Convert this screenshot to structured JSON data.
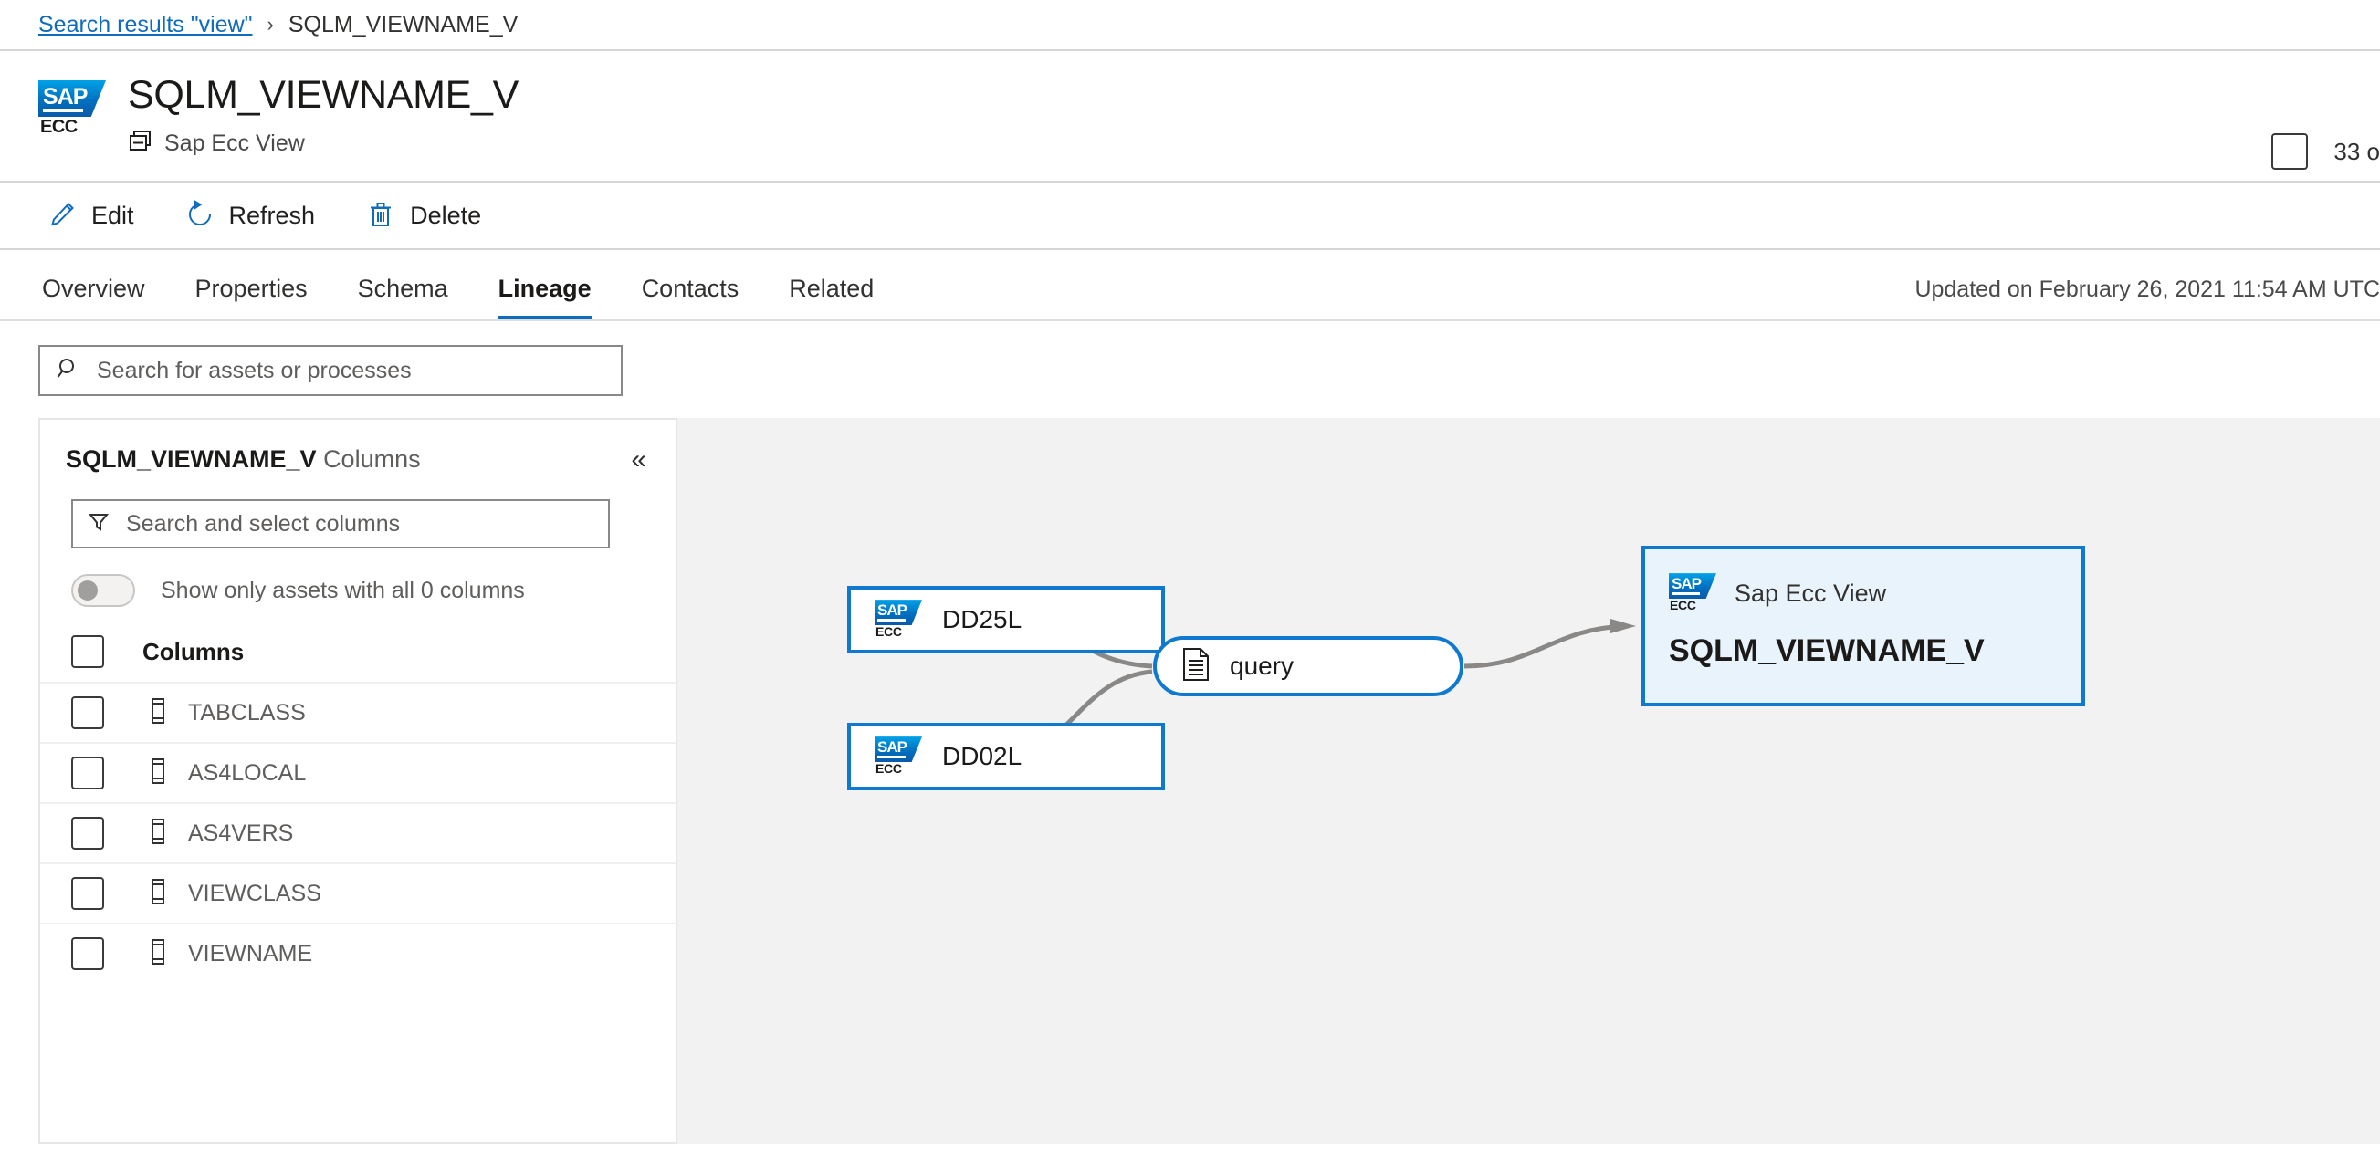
{
  "breadcrumb": {
    "link_label": "Search results \"view\"",
    "separator": "›",
    "current": "SQLM_VIEWNAME_V"
  },
  "header": {
    "title": "SQLM_VIEWNAME_V",
    "subtitle": "Sap Ecc View",
    "logo_sap": "SAP",
    "logo_ecc": "ECC",
    "right_label": "33 o"
  },
  "command_bar": {
    "edit": "Edit",
    "refresh": "Refresh",
    "delete": "Delete"
  },
  "tabs": [
    {
      "label": "Overview",
      "active": false
    },
    {
      "label": "Properties",
      "active": false
    },
    {
      "label": "Schema",
      "active": false
    },
    {
      "label": "Lineage",
      "active": true
    },
    {
      "label": "Contacts",
      "active": false
    },
    {
      "label": "Related",
      "active": false
    }
  ],
  "updated": "Updated on February 26, 2021 11:54 AM UTC",
  "lineage_search": {
    "placeholder": "Search for assets or processes",
    "value": ""
  },
  "columns_panel": {
    "title_bold": "SQLM_VIEWNAME_V",
    "title_light": "Columns",
    "collapse_icon": "«",
    "filter_placeholder": "Search and select columns",
    "filter_value": "",
    "toggle_label": "Show only assets with all 0 columns",
    "toggle_on": false,
    "header_label": "Columns",
    "items": [
      {
        "label": "TABCLASS",
        "checked": false
      },
      {
        "label": "AS4LOCAL",
        "checked": false
      },
      {
        "label": "AS4VERS",
        "checked": false
      },
      {
        "label": "VIEWCLASS",
        "checked": false
      },
      {
        "label": "VIEWNAME",
        "checked": false
      }
    ]
  },
  "graph": {
    "nodes": [
      {
        "id": "dd25l",
        "label": "DD25L",
        "kind": "source"
      },
      {
        "id": "dd02l",
        "label": "DD02L",
        "kind": "source"
      },
      {
        "id": "query",
        "label": "query",
        "kind": "process"
      },
      {
        "id": "target",
        "type_label": "Sap Ecc View",
        "label": "SQLM_VIEWNAME_V",
        "kind": "target"
      }
    ],
    "edges": [
      {
        "from": "dd25l",
        "to": "query"
      },
      {
        "from": "dd02l",
        "to": "query"
      },
      {
        "from": "query",
        "to": "target"
      }
    ]
  },
  "colors": {
    "accent": "#0f6cbd",
    "node_border": "#0f79d0",
    "target_fill": "#e8f3fc",
    "canvas": "#f2f2f2",
    "edge": "#8a8886"
  }
}
